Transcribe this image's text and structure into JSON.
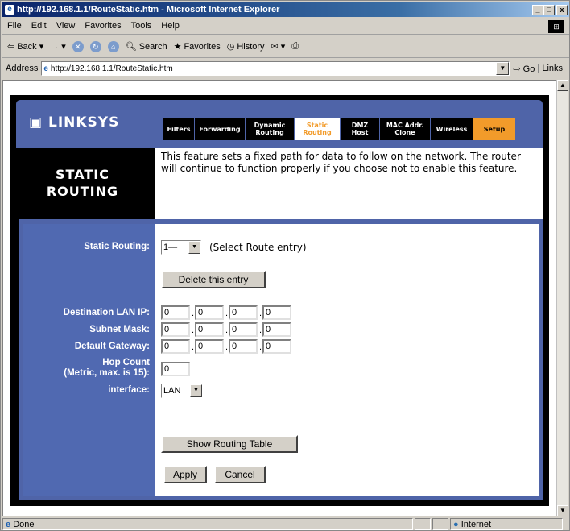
{
  "window": {
    "title": "http://192.168.1.1/RouteStatic.htm - Microsoft Internet Explorer",
    "min": "_",
    "max": "□",
    "close": "x"
  },
  "menu": [
    "File",
    "Edit",
    "View",
    "Favorites",
    "Tools",
    "Help"
  ],
  "toolbar": {
    "back": "Back",
    "forward": "→",
    "stop": "",
    "search": "Search",
    "favorites": "Favorites",
    "history": "History"
  },
  "address": {
    "label": "Address",
    "url": "http://192.168.1.1/RouteStatic.htm",
    "go": "Go",
    "links": "Links"
  },
  "brand": "LINKSYS",
  "tabs": [
    {
      "label": "Filters"
    },
    {
      "label": "Forwarding"
    },
    {
      "label": "Dynamic Routing"
    },
    {
      "label": "Static Routing",
      "active": true
    },
    {
      "label": "DMZ Host"
    },
    {
      "label": "MAC Addr. Clone"
    },
    {
      "label": "Wireless"
    },
    {
      "label": "Setup"
    }
  ],
  "section_title_1": "STATIC",
  "section_title_2": "ROUTING",
  "description": "This feature sets a fixed path for data to follow on the network. The router will continue to function properly if you choose not to enable this feature.",
  "form": {
    "static_routing_label": "Static Routing:",
    "route_select": "1—",
    "route_hint": "(Select Route entry)",
    "delete_button": "Delete this entry",
    "dest_label": "Destination LAN IP:",
    "subnet_label": "Subnet Mask:",
    "gateway_label": "Default Gateway:",
    "hop_label_1": "Hop Count",
    "hop_label_2": "(Metric, max. is 15):",
    "interface_label": "interface:",
    "dest": [
      "0",
      "0",
      "0",
      "0"
    ],
    "subnet": [
      "0",
      "0",
      "0",
      "0"
    ],
    "gateway": [
      "0",
      "0",
      "0",
      "0"
    ],
    "hop": "0",
    "interface_value": "LAN",
    "show_table_button": "Show Routing Table",
    "apply_button": "Apply",
    "cancel_button": "Cancel"
  },
  "status": {
    "text": "Done",
    "zone": "Internet"
  }
}
